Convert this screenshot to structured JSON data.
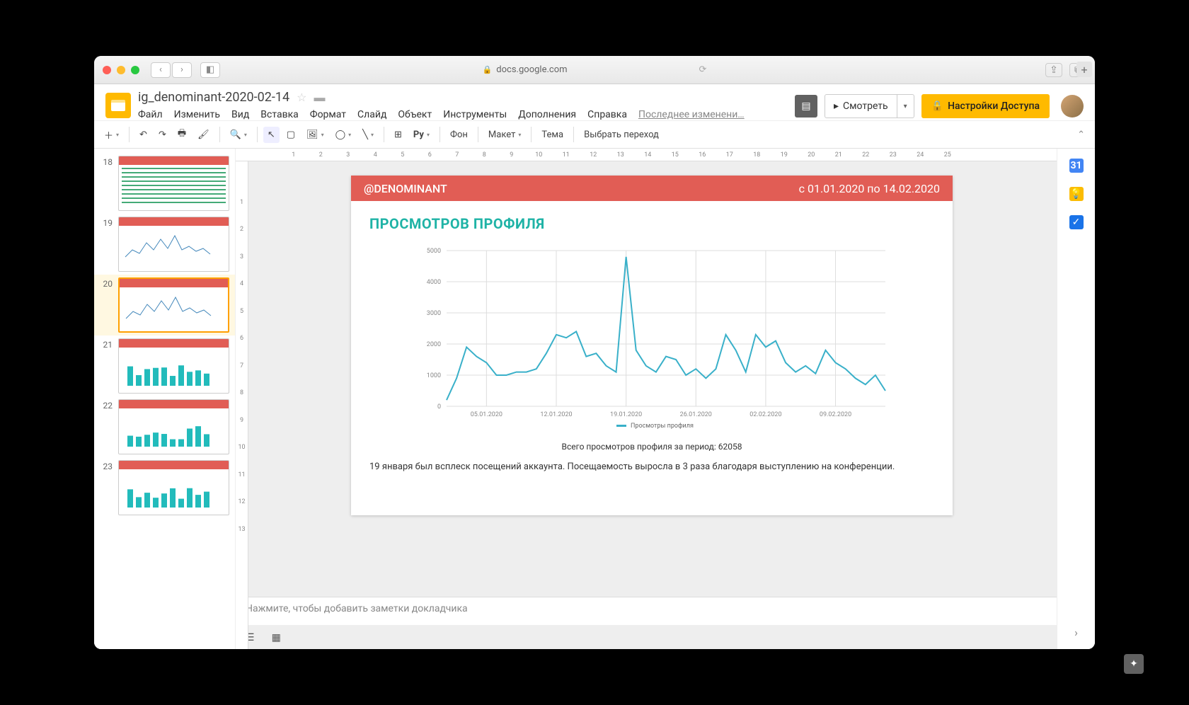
{
  "browser": {
    "url": "docs.google.com"
  },
  "doc": {
    "title": "ig_denominant-2020-02-14",
    "last_edit": "Последнее изменени…"
  },
  "menus": [
    "Файл",
    "Изменить",
    "Вид",
    "Вставка",
    "Формат",
    "Слайд",
    "Объект",
    "Инструменты",
    "Дополнения",
    "Справка"
  ],
  "header": {
    "present": "Смотреть",
    "share": "Настройки Доступа"
  },
  "toolbar": {
    "bg": "Фон",
    "layout": "Макет",
    "theme": "Тема",
    "transition": "Выбрать переход",
    "ry": "Ру"
  },
  "ruler_h": [
    " ",
    "1",
    "2",
    "3",
    "4",
    "5",
    "6",
    "7",
    "8",
    "9",
    "10",
    "11",
    "12",
    "13",
    "14",
    "15",
    "16",
    "17",
    "18",
    "19",
    "20",
    "21",
    "22",
    "23",
    "24",
    "25"
  ],
  "ruler_v": [
    "",
    "1",
    "2",
    "3",
    "4",
    "5",
    "6",
    "7",
    "8",
    "9",
    "10",
    "11",
    "12",
    "13"
  ],
  "thumbs": [
    18,
    19,
    20,
    21,
    22,
    23
  ],
  "selected_thumb": 20,
  "slide": {
    "account": "@DENOMINANT",
    "period": "с 01.01.2020 по 14.02.2020",
    "title": "ПРОСМОТРОВ ПРОФИЛЯ",
    "legend": "Просмотры профиля",
    "caption": "Всего просмотров профиля за период: 62058",
    "note": "19 января был всплеск посещений аккаунта. Посещаемость выросла в 3 раза благодаря выступлению на конференции."
  },
  "notes_placeholder": "Нажмите, чтобы добавить заметки докладчика",
  "sidebar": {
    "cal": "31"
  },
  "chart_data": {
    "type": "line",
    "title": "ПРОСМОТРОВ ПРОФИЛЯ",
    "ylabel": "",
    "xlabel": "",
    "ylim": [
      0,
      5000
    ],
    "yticks": [
      0,
      1000,
      2000,
      3000,
      4000,
      5000
    ],
    "xticks": [
      "05.01.2020",
      "12.01.2020",
      "19.01.2020",
      "26.01.2020",
      "02.02.2020",
      "09.02.2020"
    ],
    "legend": [
      "Просмотры профиля"
    ],
    "series": [
      {
        "name": "Просмотры профиля",
        "values": [
          200,
          900,
          1900,
          1600,
          1400,
          1000,
          1000,
          1100,
          1100,
          1200,
          1700,
          2300,
          2200,
          2400,
          1600,
          1700,
          1300,
          1100,
          4800,
          1800,
          1300,
          1100,
          1600,
          1500,
          1000,
          1200,
          900,
          1200,
          2300,
          1800,
          1100,
          2300,
          1900,
          2100,
          1400,
          1100,
          1300,
          1050,
          1800,
          1400,
          1200,
          900,
          700,
          1000,
          500
        ]
      }
    ],
    "total": 62058
  }
}
